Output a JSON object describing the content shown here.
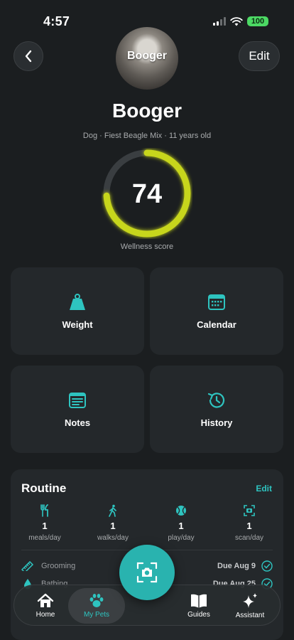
{
  "status": {
    "time": "4:57",
    "battery": "100"
  },
  "header": {
    "edit_label": "Edit",
    "avatar_label": "Booger"
  },
  "pet": {
    "name": "Booger",
    "details": "Dog · Fiest Beagle Mix · 11 years old"
  },
  "wellness": {
    "score": 74,
    "max": 100,
    "label": "Wellness score",
    "color": "#c7d61f"
  },
  "tiles": [
    {
      "label": "Weight",
      "icon": "weight-icon"
    },
    {
      "label": "Calendar",
      "icon": "calendar-icon"
    },
    {
      "label": "Notes",
      "icon": "notes-icon"
    },
    {
      "label": "History",
      "icon": "history-icon"
    }
  ],
  "routine": {
    "title": "Routine",
    "edit_label": "Edit",
    "stats": [
      {
        "value": "1",
        "unit": "meals/day",
        "icon": "utensils-icon"
      },
      {
        "value": "1",
        "unit": "walks/day",
        "icon": "walking-icon"
      },
      {
        "value": "1",
        "unit": "play/day",
        "icon": "ball-icon"
      },
      {
        "value": "1",
        "unit": "scan/day",
        "icon": "scan-icon"
      }
    ],
    "tasks": [
      {
        "name": "Grooming",
        "due": "Due Aug 9",
        "icon": "comb-icon"
      },
      {
        "name": "Bathing",
        "due": "Due Aug 25",
        "icon": "droplet-icon"
      }
    ]
  },
  "tabbar": {
    "items": [
      {
        "label": "Home",
        "icon": "home-icon"
      },
      {
        "label": "My Pets",
        "icon": "paw-icon",
        "active": true
      },
      {
        "label": "Guides",
        "icon": "book-icon"
      },
      {
        "label": "Assistant",
        "icon": "sparkle-icon"
      }
    ]
  },
  "colors": {
    "accent": "#2ec4c0",
    "ring": "#c7d61f",
    "background": "#1b1e20",
    "card": "#24282b"
  }
}
